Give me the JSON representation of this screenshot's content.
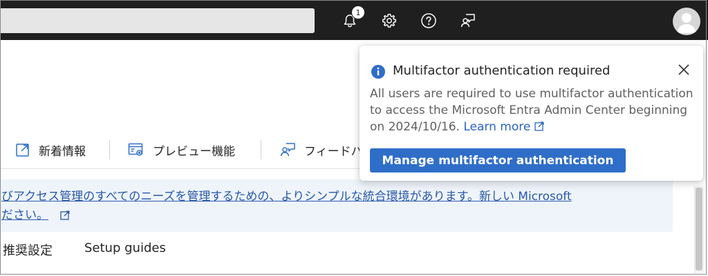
{
  "topbar": {
    "search": {
      "value": "",
      "placeholder": ""
    },
    "notifications": {
      "count": "1",
      "icon": "bell-icon"
    },
    "settings_icon": "gear-icon",
    "help_icon": "question-icon",
    "feedback_icon": "feedback-person-icon",
    "avatar_icon": "user-avatar-icon"
  },
  "toolbar": {
    "items": [
      {
        "label": "新着情報",
        "icon": "external-window-icon"
      },
      {
        "label": "プレビュー機能",
        "icon": "preview-settings-icon"
      },
      {
        "label": "フィードバ",
        "icon": "feedback-icon"
      }
    ]
  },
  "banner": {
    "line1": "びアクセス管理のすべてのニーズを管理するための、よりシンプルな統合環境があります。新しい Microsoft",
    "line2": "ださい。",
    "icon": "external-link-icon"
  },
  "tabs": [
    {
      "label": "推奨設定"
    },
    {
      "label": "Setup guides"
    }
  ],
  "popup": {
    "title": "Multifactor authentication required",
    "body": "All users are required to use multifactor authentication to access the Microsoft Entra Admin Center beginning on 2024/10/16.",
    "link_label": "Learn more",
    "button_label": "Manage multifactor authentication",
    "info_icon": "info-icon",
    "close_icon": "close-icon"
  },
  "colors": {
    "topbar_bg": "#1f1f1f",
    "accent": "#2f6ec8",
    "link": "#2a64c4",
    "info": "#2f6ec8",
    "banner_bg": "#eff4fb"
  }
}
